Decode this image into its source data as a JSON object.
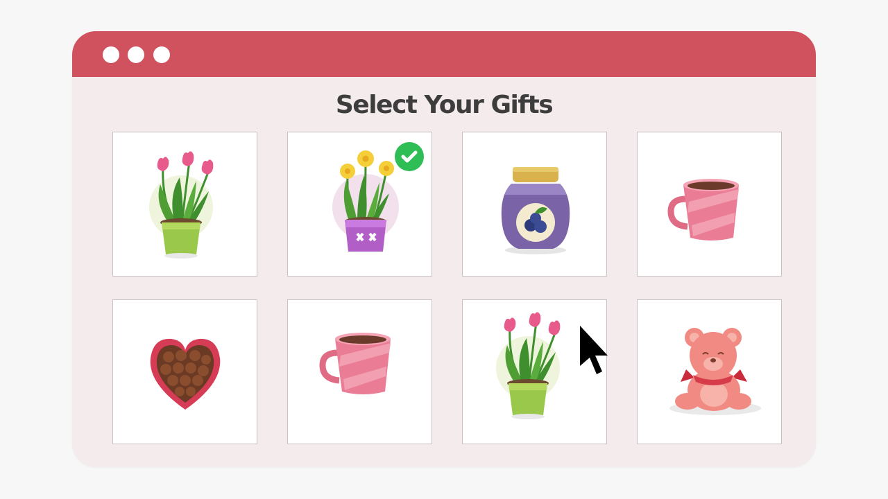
{
  "window": {
    "title": "Select Your Gifts",
    "colors": {
      "titlebar": "#d0525e",
      "background": "#f4ecec",
      "selected_check": "#2fbd55"
    }
  },
  "gifts": [
    {
      "id": "tulip-pot",
      "icon": "tulip-pot-icon",
      "selected": false
    },
    {
      "id": "daffodil-pot",
      "icon": "daffodil-pot-icon",
      "selected": true
    },
    {
      "id": "blueberry-jam",
      "icon": "jam-jar-icon",
      "selected": false
    },
    {
      "id": "pink-mug",
      "icon": "mug-icon",
      "selected": false
    },
    {
      "id": "chocolate-box",
      "icon": "heart-chocolate-box-icon",
      "selected": false
    },
    {
      "id": "pink-mug-2",
      "icon": "mug-icon",
      "selected": false
    },
    {
      "id": "tulip-pot-2",
      "icon": "tulip-pot-icon",
      "selected": false
    },
    {
      "id": "teddy-bear",
      "icon": "teddy-bear-icon",
      "selected": false
    }
  ]
}
